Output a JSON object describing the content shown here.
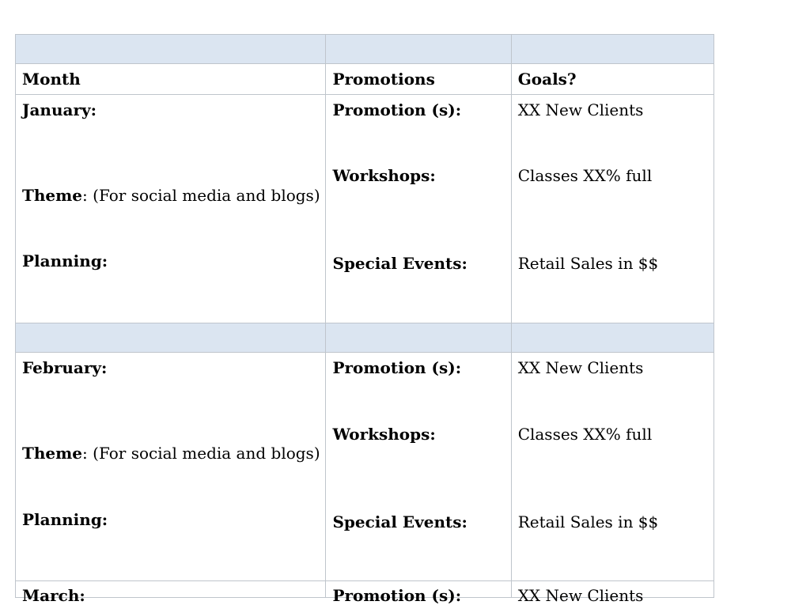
{
  "table": {
    "headers": {
      "month": "Month",
      "promotions": "Promotions",
      "goals": "Goals?"
    },
    "months": [
      {
        "name": "January:",
        "theme_label": "Theme",
        "theme_text": ":  (For social media and blogs)",
        "planning_label": "Planning:",
        "promotion_label": "Promotion (s):",
        "workshops_label": "Workshops:",
        "special_events_label": "Special Events:",
        "goal_clients": "XX New Clients",
        "goal_classes": "Classes XX% full",
        "goal_retail": "Retail Sales in $$"
      },
      {
        "name": "February:",
        "theme_label": "Theme",
        "theme_text": ":  (For social media and blogs)",
        "planning_label": "Planning:",
        "promotion_label": "Promotion (s):",
        "workshops_label": "Workshops:",
        "special_events_label": "Special Events:",
        "goal_clients": "XX New Clients",
        "goal_classes": "Classes XX% full",
        "goal_retail": "Retail Sales in $$"
      }
    ],
    "cut_off_row": {
      "month": "March:",
      "promotion": "Promotion (s):",
      "goal": "XX New Clients"
    }
  },
  "colors": {
    "band_fill": "#dbe5f1",
    "grid_line": "#bfc5cc"
  }
}
